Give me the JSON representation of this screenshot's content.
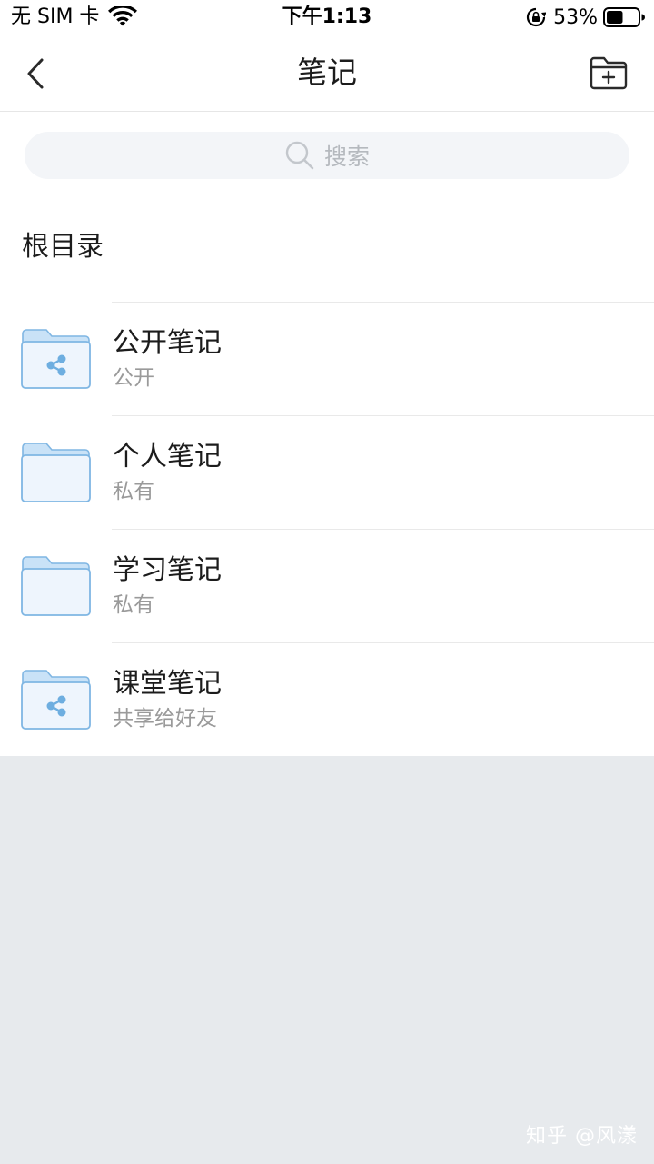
{
  "status_bar": {
    "carrier": "无 SIM 卡",
    "time": "下午1:13",
    "battery": "53%",
    "battery_level": 0.53
  },
  "nav": {
    "title": "笔记",
    "back_icon": "chevron-left-icon",
    "action_icon": "add-folder-icon"
  },
  "search": {
    "placeholder": "搜索"
  },
  "section": {
    "title": "根目录"
  },
  "folders": [
    {
      "name": "公开笔记",
      "status": "公开",
      "icon": "shared-folder-icon"
    },
    {
      "name": "个人笔记",
      "status": "私有",
      "icon": "folder-icon"
    },
    {
      "name": "学习笔记",
      "status": "私有",
      "icon": "folder-icon"
    },
    {
      "name": "课堂笔记",
      "status": "共享给好友",
      "icon": "shared-folder-icon"
    }
  ],
  "watermark": "知乎 @风漾",
  "colors": {
    "folder_fill": "#eef5fd",
    "folder_stroke": "#7fb6e3",
    "folder_tab": "#c9e2f7",
    "share_glyph": "#6eaee0",
    "background_gray": "#e7eaed"
  }
}
